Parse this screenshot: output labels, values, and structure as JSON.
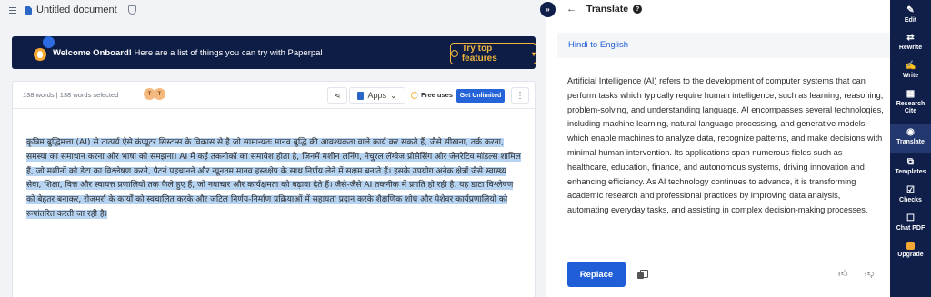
{
  "topbar": {
    "doc_title": "Untitled document"
  },
  "banner": {
    "title": "Welcome Onboard!",
    "text": " Here are a list of things you can try with Paperpal",
    "button": "Try top features"
  },
  "editor": {
    "word_count": "138 words | 138 words selected",
    "avatars": [
      "T",
      "T"
    ],
    "apps_label": "Apps",
    "free_uses_label": "Free uses",
    "unlimited_button": "Get Unlimited",
    "more": "⋮",
    "content": "कृत्रिम बुद्धिमत्ता (AI) से तात्पर्य ऐसे कंप्यूटर सिस्टम्स के विकास से है जो सामान्यतः मानव बुद्धि की आवश्यकता वाले कार्य कर सकते हैं, जैसे सीखना, तर्क करना, समस्या का समाधान करना और भाषा को समझना। AI में कई तकनीकों का समावेश होता है, जिनमें मशीन लर्निंग, नेचुरल लैंग्वेज प्रोसेसिंग और जेनरेटिव मॉडल्स शामिल हैं, जो मशीनों को डेटा का विश्लेषण करने, पैटर्न पहचानने और न्यूनतम मानव हस्तक्षेप के साथ निर्णय लेने में सक्षम बनाते हैं। इसके उपयोग अनेक क्षेत्रों जैसे स्वास्थ्य सेवा, शिक्षा, वित्त और स्वायत्त प्रणालियों तक फैले हुए हैं, जो नवाचार और कार्यक्षमता को बढ़ावा देते हैं। जैसे-जैसे AI तकनीक में प्रगति हो रही है, यह डाटा विश्लेषण को बेहतर बनाकर, रोजमर्रा के कार्यों को स्वचालित करके और जटिल निर्णय-निर्माण प्रक्रियाओं में सहायता प्रदान करके शैक्षणिक शोध और पेशेवर कार्यप्रणालियों को रूपांतरित करती जा रही है।"
  },
  "panel": {
    "title": "Translate",
    "help": "?",
    "language_pair": "Hindi to English",
    "translated_text": "Artificial Intelligence (AI) refers to the development of computer systems that can perform tasks which typically require human intelligence, such as learning, reasoning, problem-solving, and understanding language. AI encompasses several technologies, including machine learning, natural language processing, and generative models, which enable machines to analyze data, recognize patterns, and make decisions with minimal human intervention. Its applications span numerous fields such as healthcare, education, finance, and autonomous systems, driving innovation and enhancing efficiency. As AI technology continues to advance, it is transforming academic research and professional practices by improving data analysis, automating everyday tasks, and assisting in complex decision-making processes.",
    "replace_button": "Replace"
  },
  "rail": {
    "items": [
      {
        "label": "Edit",
        "icon": "✎"
      },
      {
        "label": "Rewrite",
        "icon": "⇄"
      },
      {
        "label": "Write",
        "icon": "✍"
      },
      {
        "label": "Research\nCite",
        "icon": "▦"
      },
      {
        "label": "Translate",
        "icon": "◉"
      },
      {
        "label": "Templates",
        "icon": "⧉"
      },
      {
        "label": "Checks",
        "icon": "☑"
      },
      {
        "label": "Chat PDF",
        "icon": "☐"
      },
      {
        "label": "Upgrade",
        "icon": "■"
      }
    ]
  },
  "colors": {
    "brand_navy": "#0f1f4a",
    "accent_blue": "#1f5ed6",
    "highlight": "#b6d4f2",
    "banner_gold": "#f0b43c"
  }
}
